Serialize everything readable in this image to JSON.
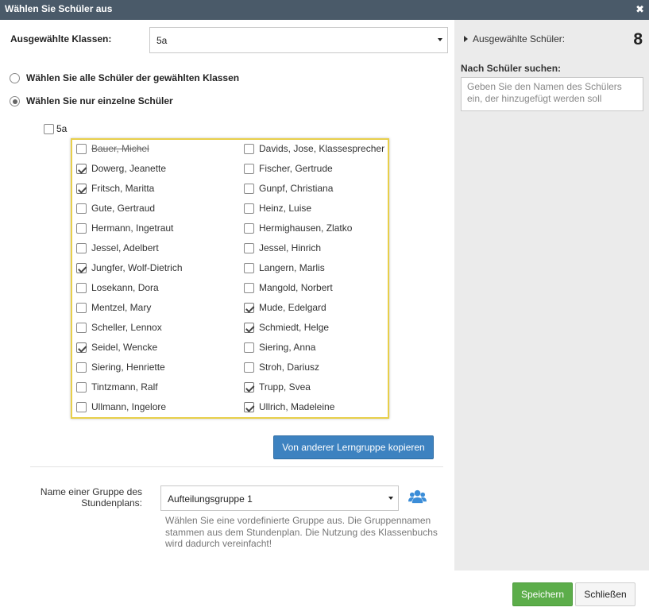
{
  "dialog": {
    "title": "Wählen Sie Schüler aus",
    "close_glyph": "✖"
  },
  "classes": {
    "label": "Ausgewählte Klassen:",
    "value": "5a"
  },
  "radios": [
    {
      "label": "Wählen Sie alle Schüler der gewählten Klassen",
      "checked": false
    },
    {
      "label": "Wählen Sie nur einzelne Schüler",
      "checked": true
    }
  ],
  "class_checkbox": {
    "label": "5a",
    "checked": false
  },
  "students_left": [
    {
      "name": "Bauer, Michel",
      "checked": false,
      "strike": true
    },
    {
      "name": "Dowerg, Jeanette",
      "checked": true,
      "strike": false
    },
    {
      "name": "Fritsch, Maritta",
      "checked": true,
      "strike": false
    },
    {
      "name": "Gute, Gertraud",
      "checked": false,
      "strike": false
    },
    {
      "name": "Hermann, Ingetraut",
      "checked": false,
      "strike": false
    },
    {
      "name": "Jessel, Adelbert",
      "checked": false,
      "strike": false
    },
    {
      "name": "Jungfer, Wolf-Dietrich",
      "checked": true,
      "strike": false
    },
    {
      "name": "Losekann, Dora",
      "checked": false,
      "strike": false
    },
    {
      "name": "Mentzel, Mary",
      "checked": false,
      "strike": false
    },
    {
      "name": "Scheller, Lennox",
      "checked": false,
      "strike": false
    },
    {
      "name": "Seidel, Wencke",
      "checked": true,
      "strike": false
    },
    {
      "name": "Siering, Henriette",
      "checked": false,
      "strike": false
    },
    {
      "name": "Tintzmann, Ralf",
      "checked": false,
      "strike": false
    },
    {
      "name": "Ullmann, Ingelore",
      "checked": false,
      "strike": false
    }
  ],
  "students_right": [
    {
      "name": "Davids, Jose, Klassesprecher",
      "checked": false,
      "strike": false
    },
    {
      "name": "Fischer, Gertrude",
      "checked": false,
      "strike": false
    },
    {
      "name": "Gunpf, Christiana",
      "checked": false,
      "strike": false
    },
    {
      "name": "Heinz, Luise",
      "checked": false,
      "strike": false
    },
    {
      "name": "Hermighausen, Zlatko",
      "checked": false,
      "strike": false
    },
    {
      "name": "Jessel, Hinrich",
      "checked": false,
      "strike": false
    },
    {
      "name": "Langern, Marlis",
      "checked": false,
      "strike": false
    },
    {
      "name": "Mangold, Norbert",
      "checked": false,
      "strike": false
    },
    {
      "name": "Mude, Edelgard",
      "checked": true,
      "strike": false
    },
    {
      "name": "Schmiedt, Helge",
      "checked": true,
      "strike": false
    },
    {
      "name": "Siering, Anna",
      "checked": false,
      "strike": false
    },
    {
      "name": "Stroh, Dariusz",
      "checked": false,
      "strike": false
    },
    {
      "name": "Trupp, Svea",
      "checked": true,
      "strike": false
    },
    {
      "name": "Ullrich, Madeleine",
      "checked": true,
      "strike": false
    }
  ],
  "copy_button": "Von anderer Lerngruppe kopieren",
  "group": {
    "label": "Name einer Gruppe des Stundenplans:",
    "value": "Aufteilungsgruppe 1",
    "hint": "Wählen Sie eine vordefinierte Gruppe aus. Die Gruppennamen stammen aus dem Stundenplan. Die Nutzung des Klassenbuchs wird dadurch vereinfacht!",
    "icon": "users-icon"
  },
  "sidebar": {
    "selected_label": "Ausgewählte Schüler:",
    "selected_count": "8",
    "search_label": "Nach Schüler suchen:",
    "search_placeholder": "Geben Sie den Namen des Schülers ein, der hinzugefügt werden soll"
  },
  "footer": {
    "save": "Speichern",
    "close": "Schließen"
  },
  "colors": {
    "titlebar": "#4a5a69",
    "highlight_border": "#e8cf4a",
    "primary_button": "#3d82c0",
    "save_button": "#5cad4a",
    "icon_blue": "#3b8dd8"
  }
}
